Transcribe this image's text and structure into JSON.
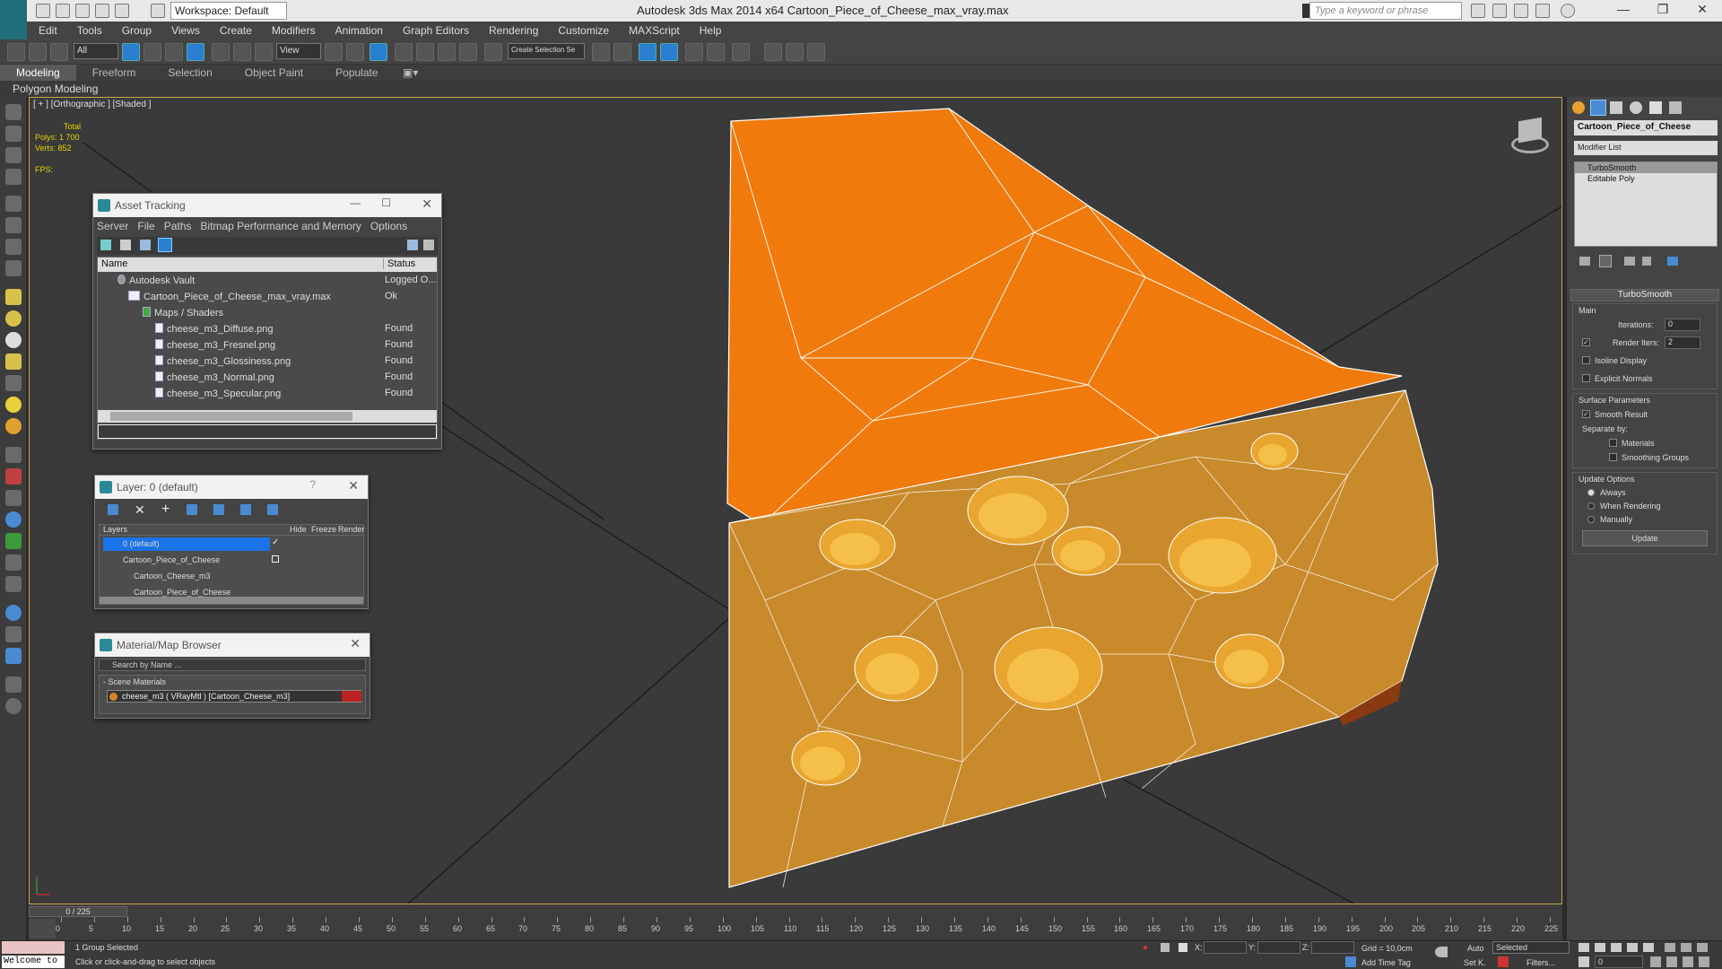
{
  "window": {
    "workspace": "Workspace: Default",
    "title": "Autodesk 3ds Max  2014 x64     Cartoon_Piece_of_Cheese_max_vray.max",
    "search_placeholder": "Type a keyword or phrase"
  },
  "menu": [
    "Edit",
    "Tools",
    "Group",
    "Views",
    "Create",
    "Modifiers",
    "Animation",
    "Graph Editors",
    "Rendering",
    "Customize",
    "MAXScript",
    "Help"
  ],
  "toolbar": {
    "filter": "All",
    "refcoord": "View",
    "named_sel": "Create Selection Se"
  },
  "ribbon": {
    "tabs": [
      "Modeling",
      "Freeform",
      "Selection",
      "Object Paint",
      "Populate"
    ],
    "active": "Modeling",
    "subtitle": "Polygon Modeling"
  },
  "viewport": {
    "label": "[ + ] [Orthographic ] [Shaded ]",
    "stats_total": "Total",
    "stats_polys": "Polys:  1 700",
    "stats_verts": "Verts:    852",
    "stats_fps": "FPS:",
    "colors": {
      "top": "#f07a0c",
      "side": "#c98a2b",
      "wire": "#ffffff"
    }
  },
  "asset_tracking": {
    "title": "Asset Tracking",
    "menu": [
      "Server",
      "File",
      "Paths",
      "Bitmap Performance and Memory",
      "Options"
    ],
    "col_name": "Name",
    "col_status": "Status",
    "rows": [
      {
        "name": "Autodesk Vault",
        "status": "Logged O..."
      },
      {
        "name": "Cartoon_Piece_of_Cheese_max_vray.max",
        "status": "Ok"
      },
      {
        "name": "Maps / Shaders",
        "status": ""
      },
      {
        "name": "cheese_m3_Diffuse.png",
        "status": "Found"
      },
      {
        "name": "cheese_m3_Fresnel.png",
        "status": "Found"
      },
      {
        "name": "cheese_m3_Glossiness.png",
        "status": "Found"
      },
      {
        "name": "cheese_m3_Normal.png",
        "status": "Found"
      },
      {
        "name": "cheese_m3_Specular.png",
        "status": "Found"
      }
    ]
  },
  "layer": {
    "title": "Layer: 0 (default)",
    "help": "?",
    "cols": {
      "layers": "Layers",
      "hide": "Hide",
      "freeze": "Freeze",
      "render": "Render"
    },
    "rows": [
      {
        "name": "0 (default)"
      },
      {
        "name": "Cartoon_Piece_of_Cheese"
      },
      {
        "name": "Cartoon_Cheese_m3"
      },
      {
        "name": "Cartoon_Piece_of_Cheese"
      }
    ]
  },
  "material_browser": {
    "title": "Material/Map Browser",
    "search": "Search by Name ...",
    "group": "- Scene Materials",
    "item": "cheese_m3  ( VRayMtl )  [Cartoon_Cheese_m3]"
  },
  "command_panel": {
    "object_name": "Cartoon_Piece_of_Cheese",
    "modifier_list": "Modifier List",
    "stack": [
      "TurboSmooth",
      "Editable Poly"
    ],
    "rollout": "TurboSmooth",
    "main": "Main",
    "iterations_label": "Iterations:",
    "iterations": "0",
    "render_iters_label": "Render Iters:",
    "render_iters": "2",
    "isoline": "Isoline Display",
    "explicit_normals": "Explicit Normals",
    "surface_params": "Surface Parameters",
    "smooth_result": "Smooth Result",
    "separate_by": "Separate by:",
    "materials": "Materials",
    "smoothing_groups": "Smoothing Groups",
    "update_options": "Update Options",
    "always": "Always",
    "when_rendering": "When Rendering",
    "manually": "Manually",
    "update_btn": "Update"
  },
  "timeline": {
    "frame": "0 / 225",
    "ticks": [
      "0",
      "5",
      "10",
      "15",
      "20",
      "25",
      "30",
      "35",
      "40",
      "45",
      "50",
      "55",
      "60",
      "65",
      "70",
      "75",
      "80",
      "85",
      "90",
      "95",
      "100",
      "105",
      "110",
      "115",
      "120",
      "125",
      "130",
      "135",
      "140",
      "145",
      "150",
      "155",
      "160",
      "165",
      "170",
      "175",
      "180",
      "185",
      "190",
      "195",
      "200",
      "205",
      "210",
      "215",
      "220",
      "225"
    ]
  },
  "status": {
    "welcome": "Welcome to",
    "selected": "1 Group Selected",
    "prompt": "Click or click-and-drag to select objects",
    "x": "X:",
    "y": "Y:",
    "z": "Z:",
    "grid": "Grid = 10,0cm",
    "add_time_tag": "Add Time Tag",
    "auto": "Auto",
    "set_key": "Set K.",
    "key_filter": "Selected",
    "filters": "Filters...",
    "frame": "0"
  }
}
